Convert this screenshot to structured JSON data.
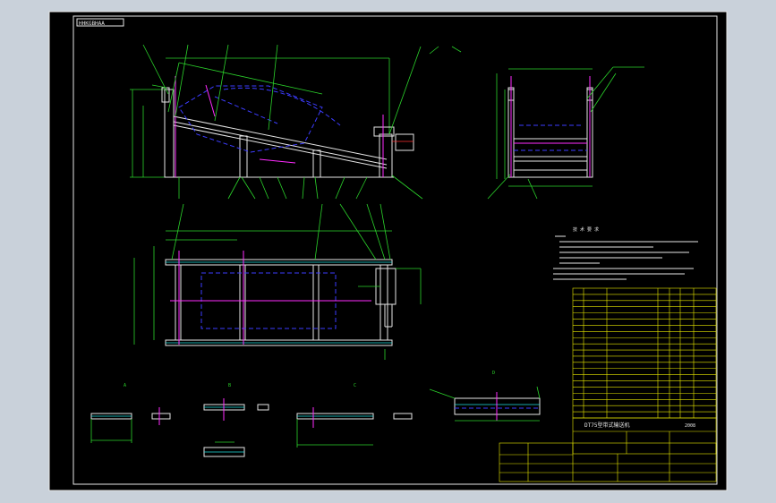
{
  "colors": {
    "background_outer": "#c9d1da",
    "paper": "#000000",
    "frame": "#e6e6e6",
    "dimension": "#2bd32b",
    "hidden": "#3c3cff",
    "center": "#ff2bff",
    "section": "#1fe0e0"
  },
  "drawing": {
    "tag": "HHKGBHAA",
    "notes_title": "技 术 要 求",
    "title_block": {
      "title": "DT75型带式输送机",
      "date": "2008"
    },
    "views": {
      "view_a": "A",
      "view_b": "B",
      "view_c": "C",
      "view_d": "D"
    }
  }
}
